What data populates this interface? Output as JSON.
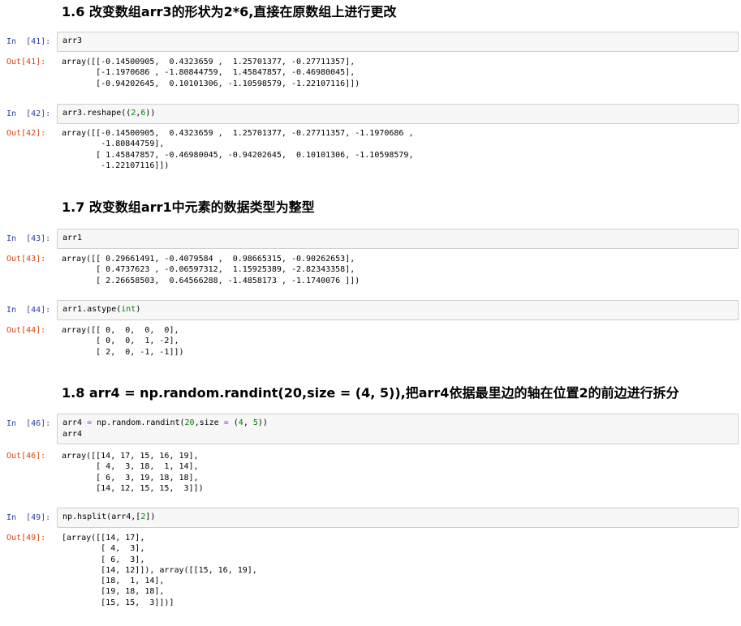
{
  "headings": {
    "h16": "1.6  改变数组arr3的形状为2*6,直接在原数组上进行更改",
    "h17": "1.7  改变数组arr1中元素的数据类型为整型",
    "h18": "1.8  arr4 = np.random.randint(20,size = (4, 5)),把arr4依据最里边的轴在位置2的前边进行拆分"
  },
  "cells": [
    {
      "in_prompt": "In  [41]:",
      "out_prompt": "Out[41]:",
      "code": "arr3",
      "output": "array([[-0.14500905,  0.4323659 ,  1.25701377, -0.27711357],\n       [-1.1970686 , -1.80844759,  1.45847857, -0.46980045],\n       [-0.94202645,  0.10101306, -1.10598579, -1.22107116]])"
    },
    {
      "in_prompt": "In  [42]:",
      "out_prompt": "Out[42]:",
      "code_parts": [
        "arr3.reshape((",
        "2",
        ",",
        "6",
        "))"
      ],
      "output": "array([[-0.14500905,  0.4323659 ,  1.25701377, -0.27711357, -1.1970686 ,\n        -1.80844759],\n       [ 1.45847857, -0.46980045, -0.94202645,  0.10101306, -1.10598579,\n        -1.22107116]])"
    },
    {
      "in_prompt": "In  [43]:",
      "out_prompt": "Out[43]:",
      "code": "arr1",
      "output": "array([[ 0.29661491, -0.4079584 ,  0.98665315, -0.90262653],\n       [ 0.4737623 , -0.06597312,  1.15925389, -2.82343358],\n       [ 2.26658503,  0.64566288, -1.4858173 , -1.1740076 ]])"
    },
    {
      "in_prompt": "In  [44]:",
      "out_prompt": "Out[44]:",
      "code_parts": [
        "arr1.astype(",
        "int",
        ")"
      ],
      "output": "array([[ 0,  0,  0,  0],\n       [ 0,  0,  1, -2],\n       [ 2,  0, -1, -1]])"
    },
    {
      "in_prompt": "In  [46]:",
      "out_prompt": "Out[46]:",
      "code_line1_parts": [
        "arr4 ",
        "=",
        " np.random.randint(",
        "20",
        ",size ",
        "=",
        " (",
        "4",
        ", ",
        "5",
        "))"
      ],
      "code_line2": "arr4",
      "output": "array([[14, 17, 15, 16, 19],\n       [ 4,  3, 18,  1, 14],\n       [ 6,  3, 19, 18, 18],\n       [14, 12, 15, 15,  3]])"
    },
    {
      "in_prompt": "In  [49]:",
      "out_prompt": "Out[49]:",
      "code_parts": [
        "np.hsplit(arr4,[",
        "2",
        "])"
      ],
      "output": "[array([[14, 17],\n        [ 4,  3],\n        [ 6,  3],\n        [14, 12]]), array([[15, 16, 19],\n        [18,  1, 14],\n        [19, 18, 18],\n        [15, 15,  3]])]"
    }
  ]
}
